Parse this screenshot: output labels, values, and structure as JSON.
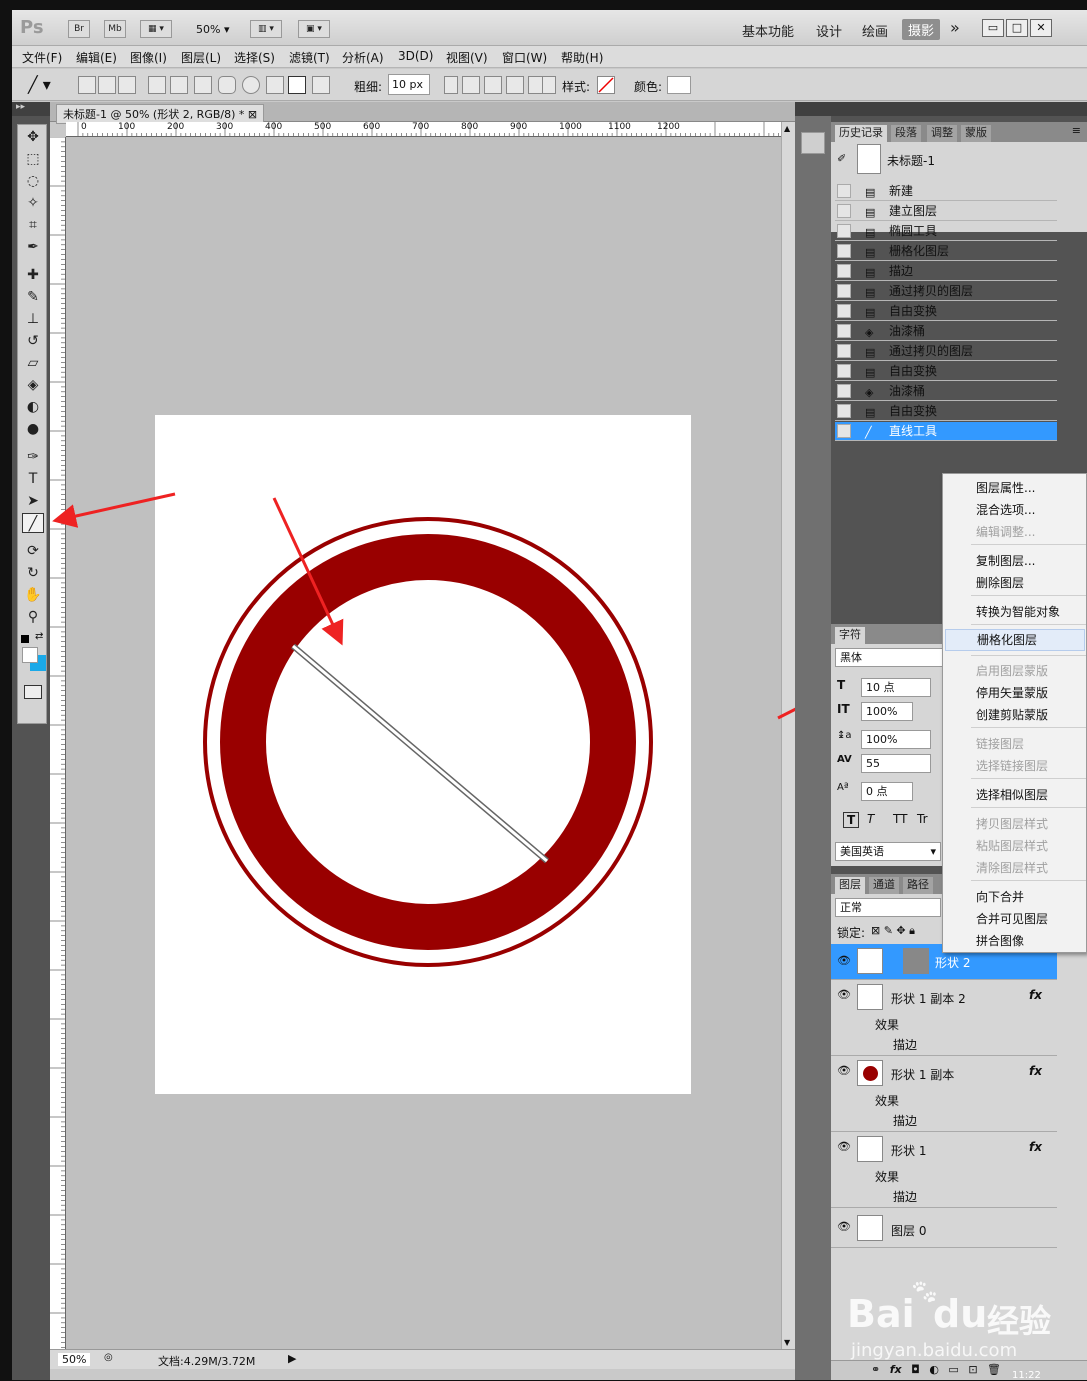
{
  "appbar": {
    "logo": "Ps",
    "bridge": "Br",
    "minibridge": "Mb",
    "zoom": "50%",
    "workspaces": [
      "基本功能",
      "设计",
      "绘画"
    ],
    "active_workspace": "摄影",
    "more": "»"
  },
  "menubar": [
    "文件(F)",
    "编辑(E)",
    "图像(I)",
    "图层(L)",
    "选择(S)",
    "滤镜(T)",
    "分析(A)",
    "3D(D)",
    "视图(V)",
    "窗口(W)",
    "帮助(H)"
  ],
  "options": {
    "weight_label": "粗细:",
    "weight_value": "10 px",
    "style_label": "样式:",
    "color_label": "颜色:"
  },
  "document": {
    "tab_title": "未标题-1 @ 50% (形状 2, RGB/8) *",
    "ruler_ticks": [
      "0",
      "100",
      "200",
      "300",
      "400",
      "500",
      "600",
      "700",
      "800",
      "900",
      "1000",
      "1100",
      "1200"
    ],
    "status_zoom": "50%",
    "status_doc": "文档:4.29M/3.72M",
    "ring_color": "#990000"
  },
  "history": {
    "tabs": [
      "历史记录",
      "段落",
      "调整",
      "蒙版"
    ],
    "snapshot": "未标题-1",
    "items": [
      "新建",
      "建立图层",
      "椭圆工具",
      "栅格化图层",
      "描边",
      "通过拷贝的图层",
      "自由变换",
      "油漆桶",
      "通过拷贝的图层",
      "自由变换",
      "油漆桶",
      "自由变换",
      "直线工具"
    ],
    "selected_index": 12
  },
  "character": {
    "tab": "字符",
    "font": "黑体",
    "size": "10 点",
    "vscale": "100%",
    "leading": "100%",
    "tracking": "55",
    "baseline": "0 点",
    "language": "美国英语",
    "style_buttons": [
      "T",
      "T",
      "TT",
      "Tr"
    ]
  },
  "layers": {
    "tabs": [
      "图层",
      "通道",
      "路径"
    ],
    "blend_mode": "正常",
    "lock_label": "锁定:",
    "rows": [
      {
        "name": "形状 2",
        "selected": true
      },
      {
        "name": "形状 1 副本 2",
        "fx": "fx",
        "effects": "效果",
        "stroke": "描边"
      },
      {
        "name": "形状 1 副本",
        "fx": "fx",
        "effects": "效果",
        "stroke": "描边"
      },
      {
        "name": "形状 1",
        "fx": "fx",
        "effects": "效果",
        "stroke": "描边"
      },
      {
        "name": "图层 0"
      }
    ]
  },
  "context_menu": {
    "items": [
      {
        "label": "图层属性...",
        "disabled": false
      },
      {
        "label": "混合选项...",
        "disabled": false
      },
      {
        "label": "编辑调整...",
        "disabled": true
      },
      {
        "label": "复制图层...",
        "disabled": false
      },
      {
        "label": "删除图层",
        "disabled": false
      },
      {
        "label": "转换为智能对象",
        "disabled": false
      },
      {
        "label": "栅格化图层",
        "disabled": false,
        "highlighted": true
      },
      {
        "label": "启用图层蒙版",
        "disabled": true
      },
      {
        "label": "停用矢量蒙版",
        "disabled": false
      },
      {
        "label": "创建剪贴蒙版",
        "disabled": false
      },
      {
        "label": "链接图层",
        "disabled": true
      },
      {
        "label": "选择链接图层",
        "disabled": true
      },
      {
        "label": "选择相似图层",
        "disabled": false
      },
      {
        "label": "拷贝图层样式",
        "disabled": true
      },
      {
        "label": "粘贴图层样式",
        "disabled": true
      },
      {
        "label": "清除图层样式",
        "disabled": true
      },
      {
        "label": "向下合并",
        "disabled": false
      },
      {
        "label": "合并可见图层",
        "disabled": false
      },
      {
        "label": "拼合图像",
        "disabled": false
      }
    ]
  },
  "watermark": {
    "brand": "Bai",
    "brand2": "du",
    "cn": "经验",
    "url": "jingyan.baidu.com"
  },
  "clock": "11:22",
  "colors": {
    "accent": "#3399ff",
    "arrow": "#ee2222",
    "ring": "#990000"
  }
}
